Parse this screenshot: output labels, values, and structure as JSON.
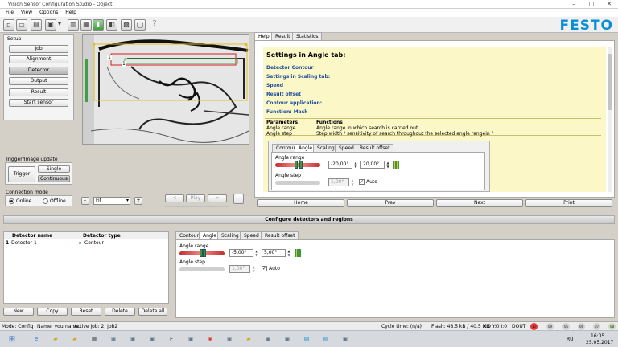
{
  "window": {
    "title": "Vision Sensor Configuration Studio - Object",
    "minimize": "–",
    "maximize": "□",
    "close": "✕"
  },
  "menu": [
    "File",
    "View",
    "Options",
    "Help"
  ],
  "toolbar_icons": [
    "new-icon",
    "open-icon",
    "save-icon",
    "device-icon",
    "dropdown-icon",
    "run-icon",
    "stop-icon",
    "green-bar-icon",
    "cube-icon",
    "grid-icon",
    "chat-icon",
    "help-icon"
  ],
  "brand": {
    "logo": "FESTO",
    "color": "#0a8ed6"
  },
  "setup": {
    "title": "Setup",
    "buttons": [
      "Job",
      "Alignment",
      "Detector",
      "Output",
      "Result",
      "Start sensor"
    ],
    "selected": "Detector"
  },
  "trigger": {
    "title": "Trigger/Image update",
    "trigger": "Trigger",
    "single": "Single",
    "continuous": "Continuous"
  },
  "connection": {
    "title": "Connection mode",
    "online": "Online",
    "offline": "Offline"
  },
  "image_view": {
    "roi1": "1",
    "roi2": "1"
  },
  "image_controls": {
    "zoom_out": "-",
    "zoom": "Fit",
    "zoom_in": "+",
    "prev": "<",
    "play": "Play",
    "next": ">"
  },
  "help_panel": {
    "tabs": [
      "Help",
      "Result",
      "Statistics"
    ],
    "active_tab": "Help",
    "heading": "Settings in Angle tab:",
    "links": [
      "Detector Contour",
      "Settings in Scaling tab:",
      "Speed",
      "Result offset",
      "Contour application:",
      "Function: Mask"
    ],
    "table": {
      "headers": [
        "Parameters",
        "Functions"
      ],
      "rows": [
        [
          "Angle range",
          "Angle range in which search is carried out"
        ],
        [
          "Angle step",
          "Step width / sensitivity of search throughout the selected angle rangein °"
        ]
      ]
    },
    "inner_tabs": [
      "Contour",
      "Angle",
      "Scaling",
      "Speed",
      "Result offset"
    ],
    "inner_active": "Angle",
    "angle_range_label": "Angle range",
    "range_min": "-20,00°",
    "range_max": "20,00°",
    "angle_step_label": "Angle step",
    "step_value": "1,00°",
    "auto": "Auto",
    "nav": [
      "Home",
      "Prev",
      "Next",
      "Print"
    ]
  },
  "configure": {
    "title": "Configure detectors and regions",
    "table": {
      "headers": [
        "Detector name",
        "Detector type"
      ],
      "rows": [
        {
          "index": "1",
          "name": "Detector 1",
          "type": "Contour"
        }
      ]
    },
    "buttons": [
      "New",
      "Copy",
      "Reset",
      "Delete",
      "Delete all"
    ],
    "tabs": [
      "Contour",
      "Angle",
      "Scaling",
      "Speed",
      "Result offset"
    ],
    "active_tab": "Angle",
    "angle_range_label": "Angle range",
    "range_min": "-5,00°",
    "range_max": "5,00°",
    "angle_step_label": "Angle step",
    "step_value": "1,00°",
    "auto": "Auto"
  },
  "status": {
    "mode": "Mode:  Config",
    "name": "Name:  yourname",
    "job": "Active job:  2, Job2",
    "cycle": "Cycle time:  (n/a)",
    "flash": "Flash:  48.5 kB / 40.5 MB",
    "xy": "X:0 Y:0 I:0",
    "dout": "DOUT",
    "leds": [
      {
        "label": "12",
        "color": "#e53935"
      },
      {
        "label": "09",
        "color": "#d0d0d0"
      },
      {
        "label": "05",
        "color": "#d0d0d0"
      },
      {
        "label": "06",
        "color": "#d0d0d0"
      },
      {
        "label": "07",
        "color": "#d0d0d0"
      },
      {
        "label": "08",
        "color": "#c9ddb8"
      }
    ]
  },
  "taskbar": {
    "start": "⊞",
    "lang": "RU",
    "time": "16:05",
    "date": "25.05.2017",
    "apps": [
      "ie-icon",
      "folder-icon",
      "folder-icon",
      "calculator-icon",
      "app-icon",
      "app-icon",
      "app-icon",
      "fd-icon",
      "app-icon",
      "chrome-icon",
      "app-icon",
      "folder-icon",
      "app-icon",
      "app-icon",
      "festo-icon",
      "festo-icon",
      "app-icon"
    ]
  }
}
